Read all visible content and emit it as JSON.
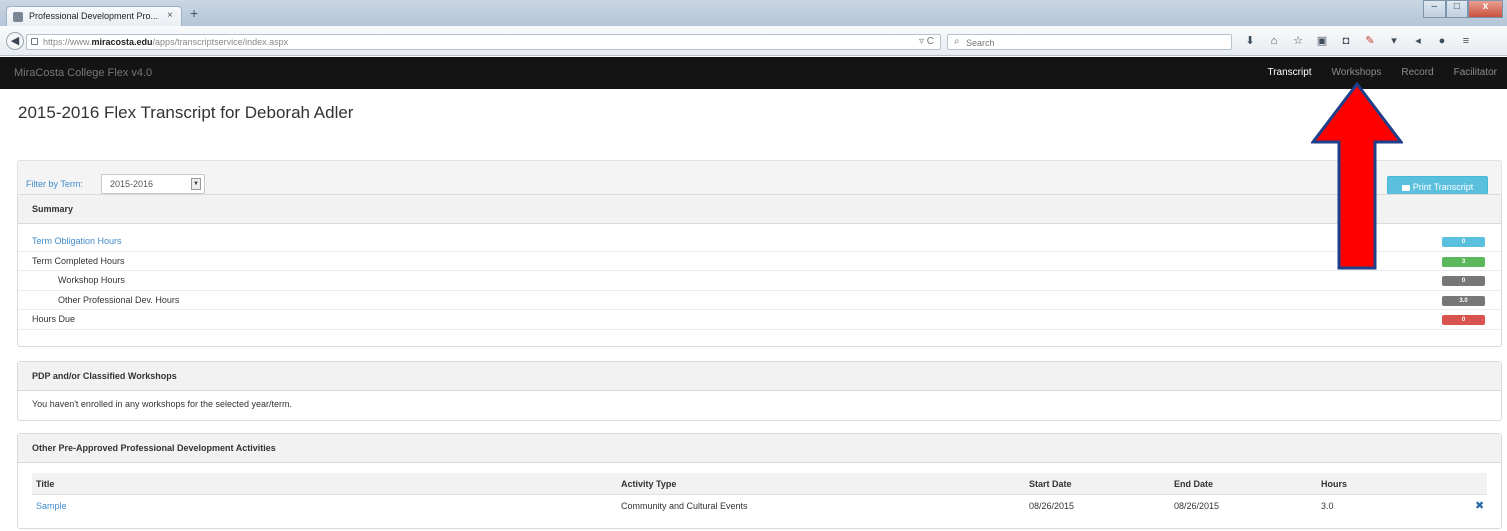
{
  "browser": {
    "tab_title": "Professional Development Pro...",
    "tab_close": "×",
    "new_tab": "+",
    "window_controls": [
      "–",
      "□",
      "x"
    ],
    "back": "◀",
    "url_prefix": "https://www.",
    "url_domain": "miracosta.edu",
    "url_path": "/apps/transcriptservice/index.aspx",
    "reload": "▿ C",
    "search_placeholder": "Search",
    "search_glyph": "⌕",
    "toolbar_icons": [
      "download-icon",
      "home-icon",
      "bookmark-star-icon",
      "clipboard-icon",
      "pocket-icon",
      "extension-icon",
      "dropdown-icon",
      "send-icon",
      "chat-icon",
      "menu-icon"
    ],
    "toolbar_glyphs": [
      "⬇",
      "⌂",
      "☆",
      "▣",
      "◘",
      "✎",
      "▾",
      "◂",
      "●",
      "≡"
    ]
  },
  "app": {
    "brand": "MiraCosta College Flex v4.0",
    "nav": [
      {
        "label": "Transcript",
        "active": true
      },
      {
        "label": "Workshops",
        "active": false
      },
      {
        "label": "Record",
        "active": false
      },
      {
        "label": "Facilitator",
        "active": false
      }
    ]
  },
  "page": {
    "title": "2015-2016 Flex Transcript for Deborah Adler"
  },
  "filter": {
    "label": "Filter by Term:",
    "selected_term": "2015-2016",
    "print_label": "Print Transcript"
  },
  "summary": {
    "heading": "Summary",
    "rows": [
      {
        "label": "Term Obligation Hours",
        "value": "0",
        "color": "#5bc0de"
      },
      {
        "label": "Term Completed Hours",
        "value": "3",
        "color": "#5cb85c"
      },
      {
        "label": "Workshop Hours",
        "value": "0",
        "color": "#777777"
      },
      {
        "label": "Other Professional Dev. Hours",
        "value": "3.0",
        "color": "#777777"
      },
      {
        "label": "Hours Due",
        "value": "0",
        "color": "#d9534f"
      }
    ]
  },
  "workshops": {
    "heading": "PDP and/or Classified Workshops",
    "empty_message": "You haven't enrolled in any workshops for the selected year/term."
  },
  "other_activities": {
    "heading": "Other Pre-Approved Professional Development Activities",
    "columns": [
      "Title",
      "Activity Type",
      "Start Date",
      "End Date",
      "Hours"
    ],
    "rows": [
      {
        "title": "Sample",
        "activity_type": "Community and Cultural Events",
        "start_date": "08/26/2015",
        "end_date": "08/26/2015",
        "hours": "3.0",
        "delete": "✖"
      }
    ]
  },
  "annotation": {
    "arrow_color": "#ff0000",
    "arrow_outline": "#1f3f8a"
  }
}
